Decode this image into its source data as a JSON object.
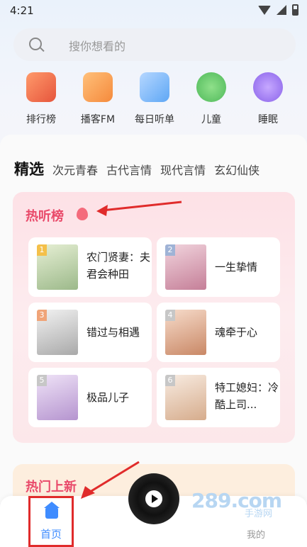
{
  "status": {
    "time": "4:21"
  },
  "search": {
    "placeholder": "搜你想看的"
  },
  "categories": [
    {
      "label": "排行榜",
      "icon": "ranking-icon",
      "color": "#f07a4a"
    },
    {
      "label": "播客FM",
      "icon": "radio-icon",
      "color": "#f59a4a"
    },
    {
      "label": "每日听单",
      "icon": "playlist-icon",
      "color": "#5ea7f5"
    },
    {
      "label": "儿童",
      "icon": "kids-icon",
      "color": "#5fc86a"
    },
    {
      "label": "睡眠",
      "icon": "moon-icon",
      "color": "#9b7af0"
    }
  ],
  "tabs": {
    "active": "精选",
    "items": [
      "次元青春",
      "古代言情",
      "现代言情",
      "玄幻仙侠"
    ]
  },
  "hot": {
    "title": "热听榜",
    "books": [
      {
        "rank": "1",
        "title": "农门贤妻：夫君会种田",
        "cover_color": "#c9d8b0",
        "rank_color": "#f4c04a"
      },
      {
        "rank": "2",
        "title": "一生挚情",
        "cover_color": "#d9a6b8",
        "rank_color": "#9fb3d6"
      },
      {
        "rank": "3",
        "title": "错过与相遇",
        "cover_color": "#c8c8c8",
        "rank_color": "#f0a478"
      },
      {
        "rank": "4",
        "title": "魂牵于心",
        "cover_color": "#e7b8a0",
        "rank_color": "#c7c7c7"
      },
      {
        "rank": "5",
        "title": "极品儿子",
        "cover_color": "#d6c2e6",
        "rank_color": "#c7c7c7"
      },
      {
        "rank": "6",
        "title": "特工媳妇：冷酷上司...",
        "cover_color": "#e8d3c4",
        "rank_color": "#c7c7c7"
      }
    ]
  },
  "new_section": {
    "title": "热门上新"
  },
  "nav": {
    "home": "首页",
    "mine": "我的"
  },
  "watermark": {
    "main": "289.com",
    "sub": "手游网"
  }
}
